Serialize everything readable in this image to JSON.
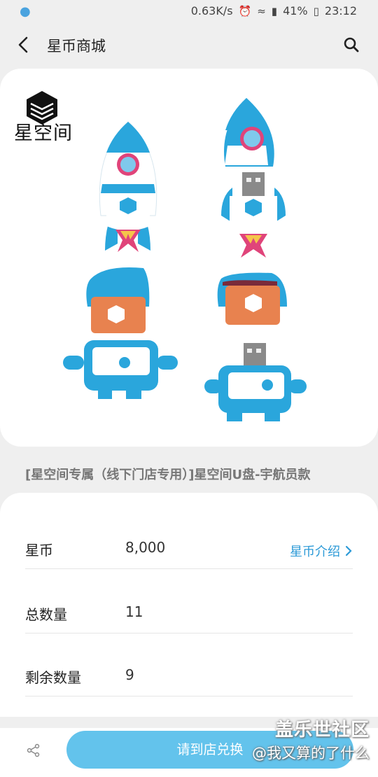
{
  "status_bar": {
    "speed": "0.63K/s",
    "battery": "41%",
    "time": "23:12"
  },
  "header": {
    "title": "星币商城"
  },
  "product": {
    "brand_name": "星空间",
    "title": "[星空间专属（线下门店专用）]星空间U盘-宇航员款"
  },
  "details": {
    "rows": [
      {
        "label": "星币",
        "value": "8,000",
        "link": "星币介绍"
      },
      {
        "label": "总数量",
        "value": "11"
      },
      {
        "label": "剩余数量",
        "value": "9"
      }
    ]
  },
  "bottom": {
    "button_label": "请到店兑换"
  },
  "watermark": {
    "line1": "盖乐世社区",
    "line2": "@我又算的了什么"
  },
  "colors": {
    "accent": "#2c9ad7",
    "button": "#63c3ec",
    "rocket_blue": "#2aa6dc",
    "visor_orange": "#e8824f"
  }
}
